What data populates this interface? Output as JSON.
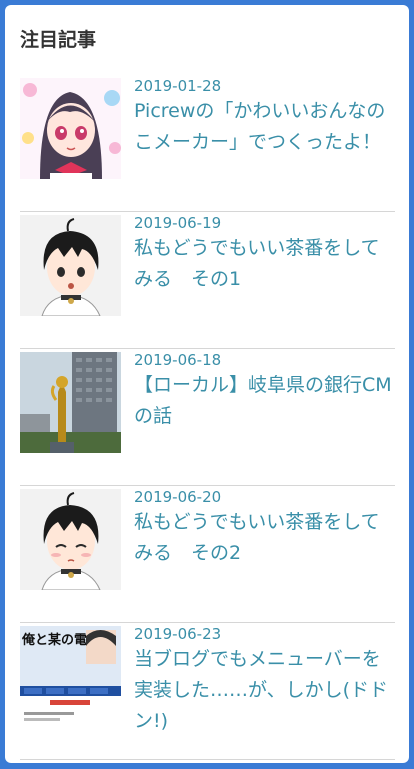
{
  "widget": {
    "heading": "注目記事",
    "articles": [
      {
        "date": "2019-01-28",
        "title": "Picrewの「かわいいおんなのこメーカー」でつくったよ！",
        "thumb": "anime-girl-icon"
      },
      {
        "date": "2019-06-19",
        "title": "私もどうでもいい茶番をしてみる　その1",
        "thumb": "avatar-boy-icon"
      },
      {
        "date": "2019-06-18",
        "title": "【ローカル】岐阜県の銀行CMの話",
        "thumb": "statue-photo-icon"
      },
      {
        "date": "2019-06-20",
        "title": "私もどうでもいい茶番をしてみる　その2",
        "thumb": "avatar-boy-sleeping-icon"
      },
      {
        "date": "2019-06-23",
        "title": "当ブログでもメニューバーを実装した……が、しかし(ドドン!)",
        "thumb": "blog-screenshot-icon",
        "thumb_text": "俺と某の電撃戦"
      }
    ]
  },
  "colors": {
    "page_bg": "#3a7bd5",
    "link": "#3a8fa8",
    "divider": "#d6d6d6"
  }
}
